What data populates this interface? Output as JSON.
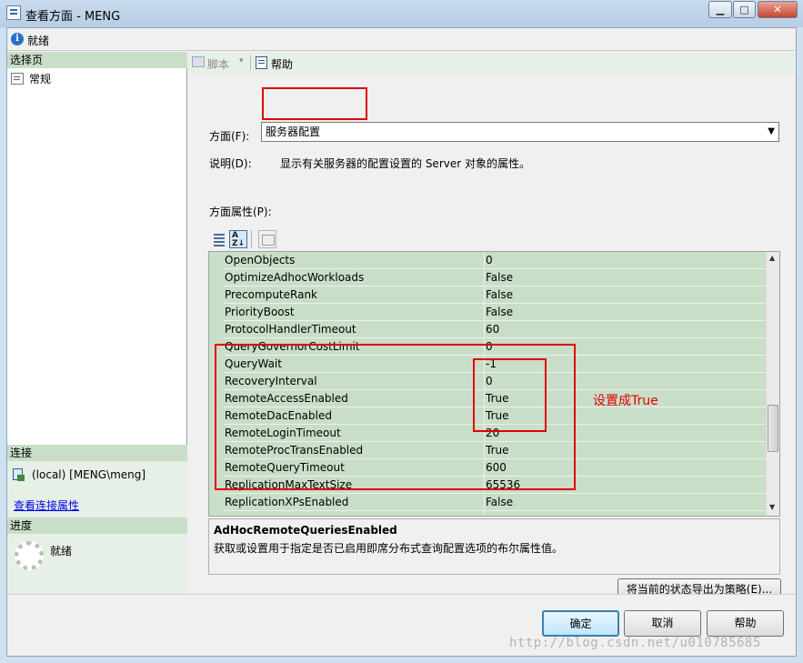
{
  "window": {
    "title": "查看方面 - MENG",
    "min_label": "▁",
    "max_label": "□",
    "close_label": "✕"
  },
  "status": {
    "text": "就绪"
  },
  "left_pane": {
    "select_page_header": "选择页",
    "nav_items": [
      {
        "label": "常规"
      }
    ],
    "connection_header": "连接",
    "connection_text": "(local) [MENG\\meng]",
    "connection_link": "查看连接属性",
    "progress_header": "进度",
    "progress_text": "就绪"
  },
  "toolbar": {
    "script_label": "脚本",
    "script_caret": "▾",
    "help_label": "帮助"
  },
  "facet": {
    "label": "方面(F):",
    "value": "服务器配置",
    "arrow": "▼"
  },
  "description": {
    "label": "说明(D):",
    "text": "显示有关服务器的配置设置的 Server 对象的属性。"
  },
  "facet_properties": {
    "label": "方面属性(P):",
    "alpha_icon_text": "A\nZ↓",
    "rows": [
      {
        "name": "OpenObjects",
        "value": "0"
      },
      {
        "name": "OptimizeAdhocWorkloads",
        "value": "False"
      },
      {
        "name": "PrecomputeRank",
        "value": "False"
      },
      {
        "name": "PriorityBoost",
        "value": "False"
      },
      {
        "name": "ProtocolHandlerTimeout",
        "value": "60"
      },
      {
        "name": "QueryGovernorCostLimit",
        "value": "0"
      },
      {
        "name": "QueryWait",
        "value": "-1"
      },
      {
        "name": "RecoveryInterval",
        "value": "0"
      },
      {
        "name": "RemoteAccessEnabled",
        "value": "True"
      },
      {
        "name": "RemoteDacEnabled",
        "value": "True"
      },
      {
        "name": "RemoteLoginTimeout",
        "value": "20"
      },
      {
        "name": "RemoteProcTransEnabled",
        "value": "True"
      },
      {
        "name": "RemoteQueryTimeout",
        "value": "600"
      },
      {
        "name": "ReplicationMaxTextSize",
        "value": "65536"
      },
      {
        "name": "ReplicationXPsEnabled",
        "value": "False"
      }
    ],
    "scroll_up": "▲",
    "scroll_down": "▼"
  },
  "help_panel": {
    "title": "AdHocRemoteQueriesEnabled",
    "text": "获取或设置用于指定是否已启用即席分布式查询配置选项的布尔属性值。"
  },
  "export_button": "将当前的状态导出为策略(E)...",
  "footer": {
    "ok": "确定",
    "cancel": "取消",
    "help": "帮助"
  },
  "annotation": "设置成True",
  "watermark": "http://blog.csdn.net/u010785685"
}
